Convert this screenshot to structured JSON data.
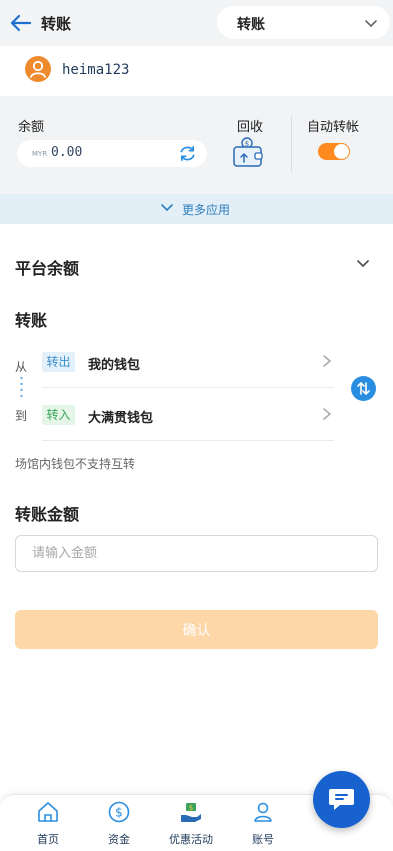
{
  "header": {
    "title": "转账",
    "dropdown_value": "转账"
  },
  "user": {
    "username": "heima123"
  },
  "wallet": {
    "balance_label": "余额",
    "currency": "MYR",
    "balance": "0.00",
    "recycle_label": "回收",
    "auto_transfer_label": "自动转帐",
    "auto_transfer_on": true,
    "colors": {
      "toggle": "#ff8a1f"
    }
  },
  "more_apps": {
    "label": "更多应用"
  },
  "platform_balance": {
    "title": "平台余额"
  },
  "transfer": {
    "title": "转账",
    "from_label": "从",
    "to_label": "到",
    "out_tag": "转出",
    "in_tag": "转入",
    "from_wallet": "我的钱包",
    "to_wallet": "大满贯钱包",
    "note": "场馆内钱包不支持互转"
  },
  "amount": {
    "title": "转账金额",
    "placeholder": "请输入金额"
  },
  "confirm": {
    "label": "确认"
  },
  "nav": {
    "items": [
      {
        "label": "首页",
        "icon": "home-icon"
      },
      {
        "label": "资金",
        "icon": "dollar-icon"
      },
      {
        "label": "优惠活动",
        "icon": "gift-hand-icon"
      },
      {
        "label": "账号",
        "icon": "user-icon"
      }
    ]
  }
}
